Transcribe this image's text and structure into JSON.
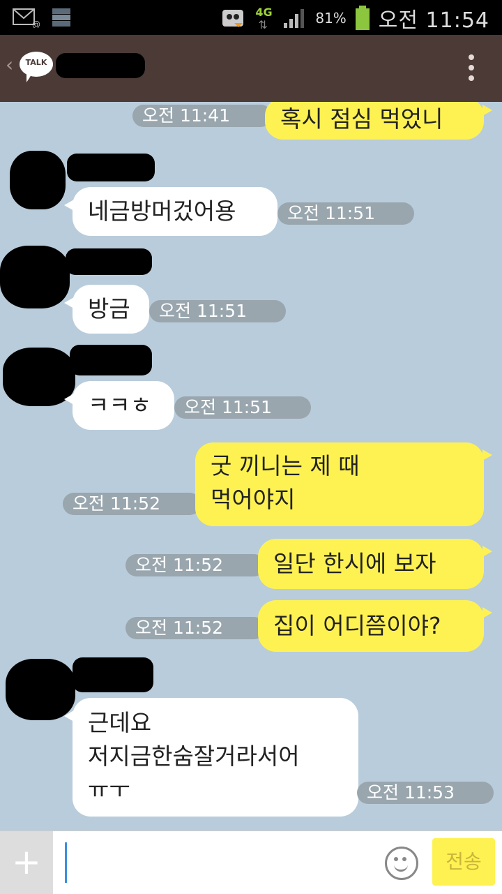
{
  "status_bar": {
    "network": "4G",
    "battery": "81%",
    "time": "오전 11:54"
  },
  "header": {
    "logo_text": "TALK"
  },
  "messages": [
    {
      "side": "out",
      "text": "혹시 점심 먹었니",
      "time": "오전 11:41"
    },
    {
      "side": "in",
      "text": "네금방머겄어용",
      "time": "오전 11:51"
    },
    {
      "side": "in",
      "text": "방금",
      "time": "오전 11:51"
    },
    {
      "side": "in",
      "text": "ㅋㅋㅎ",
      "time": "오전 11:51"
    },
    {
      "side": "out",
      "text": "굿 끼니는 제 때\n먹어야지",
      "time": "오전 11:52"
    },
    {
      "side": "out",
      "text": "일단 한시에 보자",
      "time": "오전 11:52"
    },
    {
      "side": "out",
      "text": "집이 어디쯤이야?",
      "time": "오전 11:52"
    },
    {
      "side": "in",
      "text": "근데요\n저지금한숨잘거라서어\nㅠㅜ",
      "time": "오전 11:53"
    }
  ],
  "input": {
    "plus_label": "+",
    "send_label": "전송"
  },
  "colors": {
    "chat_bg": "#b9ccdb",
    "outgoing_bubble": "#fef252",
    "incoming_bubble": "#ffffff",
    "header_bg": "#4b3a36"
  }
}
